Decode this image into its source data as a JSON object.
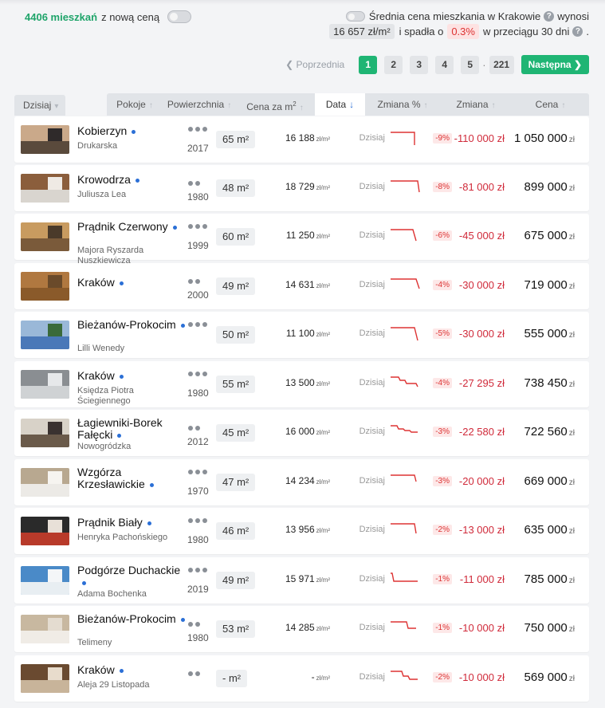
{
  "top": {
    "count": "4406 mieszkań",
    "count_suffix": "z nową ceną",
    "avg_prefix": "Średnia cena mieszkania w Krakowie",
    "avg_suffix": "wynosi",
    "avg_value": "16 657 zł/m²",
    "fall_text": "i spadła o",
    "fall_pct": "0.3%",
    "period": "w przeciągu 30 dni",
    "period_end": "."
  },
  "pager": {
    "prev": "Poprzednia",
    "pages": [
      "1",
      "2",
      "3",
      "4",
      "5"
    ],
    "ellipsis": "·",
    "last": "221",
    "next": "Następna"
  },
  "header": {
    "period": "Dzisiaj",
    "cols": [
      "Pokoje",
      "Powierzchnia",
      "Cena za m",
      "Data",
      "Zmiana %",
      "Zmiana",
      "Cena"
    ],
    "sup2": "2"
  },
  "units": {
    "m2": "m²",
    "zlm2": "zł/m²",
    "zl": "zł"
  },
  "rows": [
    {
      "district": "Kobierzyn",
      "street": "Drukarska",
      "rooms": 3,
      "year": "2017",
      "area": "65",
      "ppm": "16 188",
      "date": "Dzisiaj",
      "pct": "-9%",
      "change": "-110 000 zł",
      "price": "1 050 000",
      "palette": [
        "#5a4a3c",
        "#caa98a",
        "#2f2a2a"
      ]
    },
    {
      "district": "Krowodrza",
      "street": "Juliusza Lea",
      "rooms": 2,
      "year": "1980",
      "area": "48",
      "ppm": "18 729",
      "date": "Dzisiaj",
      "pct": "-8%",
      "change": "-81 000 zł",
      "price": "899 000",
      "palette": [
        "#d9d5cf",
        "#8b5e3c",
        "#efeae4"
      ]
    },
    {
      "district": "Prądnik Czerwony",
      "street": "Majora Ryszarda Nuszkiewicza",
      "rooms": 3,
      "year": "1999",
      "area": "60",
      "ppm": "11 250",
      "date": "Dzisiaj",
      "pct": "-6%",
      "change": "-45 000 zł",
      "price": "675 000",
      "palette": [
        "#7a5a3a",
        "#c89b60",
        "#4a3a2a"
      ]
    },
    {
      "district": "Kraków",
      "street": "",
      "rooms": 2,
      "year": "2000",
      "area": "49",
      "ppm": "14 631",
      "date": "Dzisiaj",
      "pct": "-4%",
      "change": "-30 000 zł",
      "price": "719 000",
      "palette": [
        "#8a5a2a",
        "#b07840",
        "#6a4a2a"
      ]
    },
    {
      "district": "Bieżanów-Prokocim",
      "street": "Lilli Wenedy",
      "rooms": 3,
      "year": "",
      "area": "50",
      "ppm": "11 100",
      "date": "Dzisiaj",
      "pct": "-5%",
      "change": "-30 000 zł",
      "price": "555 000",
      "palette": [
        "#4a78b8",
        "#9ab8d8",
        "#3a6a3a"
      ]
    },
    {
      "district": "Kraków",
      "street": "Księdza Piotra Ściegiennego",
      "rooms": 3,
      "year": "1980",
      "area": "55",
      "ppm": "13 500",
      "date": "Dzisiaj",
      "pct": "-4%",
      "change": "-27 295 zł",
      "price": "738 450",
      "palette": [
        "#cfd2d4",
        "#8a8e92",
        "#e6e8ea"
      ]
    },
    {
      "district": "Łagiewniki-Borek Fałęcki",
      "street": "Nowogródzka",
      "rooms": 2,
      "year": "2012",
      "area": "45",
      "ppm": "16 000",
      "date": "Dzisiaj",
      "pct": "-3%",
      "change": "-22 580 zł",
      "price": "722 560",
      "palette": [
        "#6a5a4a",
        "#d8d2c8",
        "#3a3230"
      ]
    },
    {
      "district": "Wzgórza Krzesławickie",
      "street": "",
      "rooms": 3,
      "year": "1970",
      "area": "47",
      "ppm": "14 234",
      "date": "Dzisiaj",
      "pct": "-3%",
      "change": "-20 000 zł",
      "price": "669 000",
      "palette": [
        "#eceae6",
        "#b8a890",
        "#f6f4f0"
      ]
    },
    {
      "district": "Prądnik Biały",
      "street": "Henryka Pachońskiego",
      "rooms": 3,
      "year": "1980",
      "area": "46",
      "ppm": "13 956",
      "date": "Dzisiaj",
      "pct": "-2%",
      "change": "-13 000 zł",
      "price": "635 000",
      "palette": [
        "#b83a2a",
        "#2a2a2a",
        "#e8e0d8"
      ]
    },
    {
      "district": "Podgórze Duchackie",
      "street": "Adama Bochenka",
      "rooms": 3,
      "year": "2019",
      "area": "49",
      "ppm": "15 971",
      "date": "Dzisiaj",
      "pct": "-1%",
      "change": "-11 000 zł",
      "price": "785 000",
      "palette": [
        "#e8eef2",
        "#4a8ac8",
        "#f4f6f8"
      ]
    },
    {
      "district": "Bieżanów-Prokocim",
      "street": "Telimeny",
      "rooms": 2,
      "year": "1980",
      "area": "53",
      "ppm": "14 285",
      "date": "Dzisiaj",
      "pct": "-1%",
      "change": "-10 000 zł",
      "price": "750 000",
      "palette": [
        "#f0ece6",
        "#c8b8a0",
        "#e4dcd0"
      ]
    },
    {
      "district": "Kraków",
      "street": "Aleja 29 Listopada",
      "rooms": 2,
      "year": "",
      "area": "-",
      "ppm": "-",
      "date": "Dzisiaj",
      "pct": "-2%",
      "change": "-10 000 zł",
      "price": "569 000",
      "palette": [
        "#c8b49a",
        "#6a4a30",
        "#e8dccc"
      ]
    }
  ]
}
